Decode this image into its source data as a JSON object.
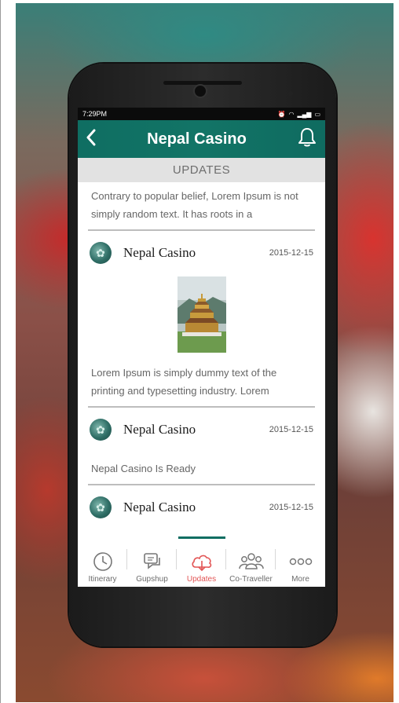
{
  "status": {
    "time": "7:29PM"
  },
  "header": {
    "title": "Nepal Casino",
    "back_icon": "back-arrow-icon",
    "bell_icon": "bell-icon"
  },
  "section": {
    "title": "UPDATES"
  },
  "feed": {
    "top_snippet": "Contrary to popular belief, Lorem Ipsum is not simply random text. It has roots in a",
    "posts": [
      {
        "name": "Nepal Casino",
        "date": "2015-12-15",
        "has_image": true,
        "text": "Lorem Ipsum is simply dummy text of the printing and typesetting industry. Lorem"
      },
      {
        "name": "Nepal Casino",
        "date": "2015-12-15",
        "has_image": false,
        "text": "Nepal Casino  Is Ready"
      },
      {
        "name": "Nepal Casino",
        "date": "2015-12-15",
        "has_image": false,
        "text": ""
      }
    ]
  },
  "nav": {
    "active": "Updates",
    "items": [
      {
        "label": "Itinerary",
        "icon": "clock-icon"
      },
      {
        "label": "Gupshup",
        "icon": "chat-icon"
      },
      {
        "label": "Updates",
        "icon": "cloud-icon"
      },
      {
        "label": "Co-Traveller",
        "icon": "people-icon"
      },
      {
        "label": "More",
        "icon": "more-icon"
      }
    ]
  },
  "colors": {
    "primary": "#0f6e62",
    "active_tab": "#e25555"
  }
}
